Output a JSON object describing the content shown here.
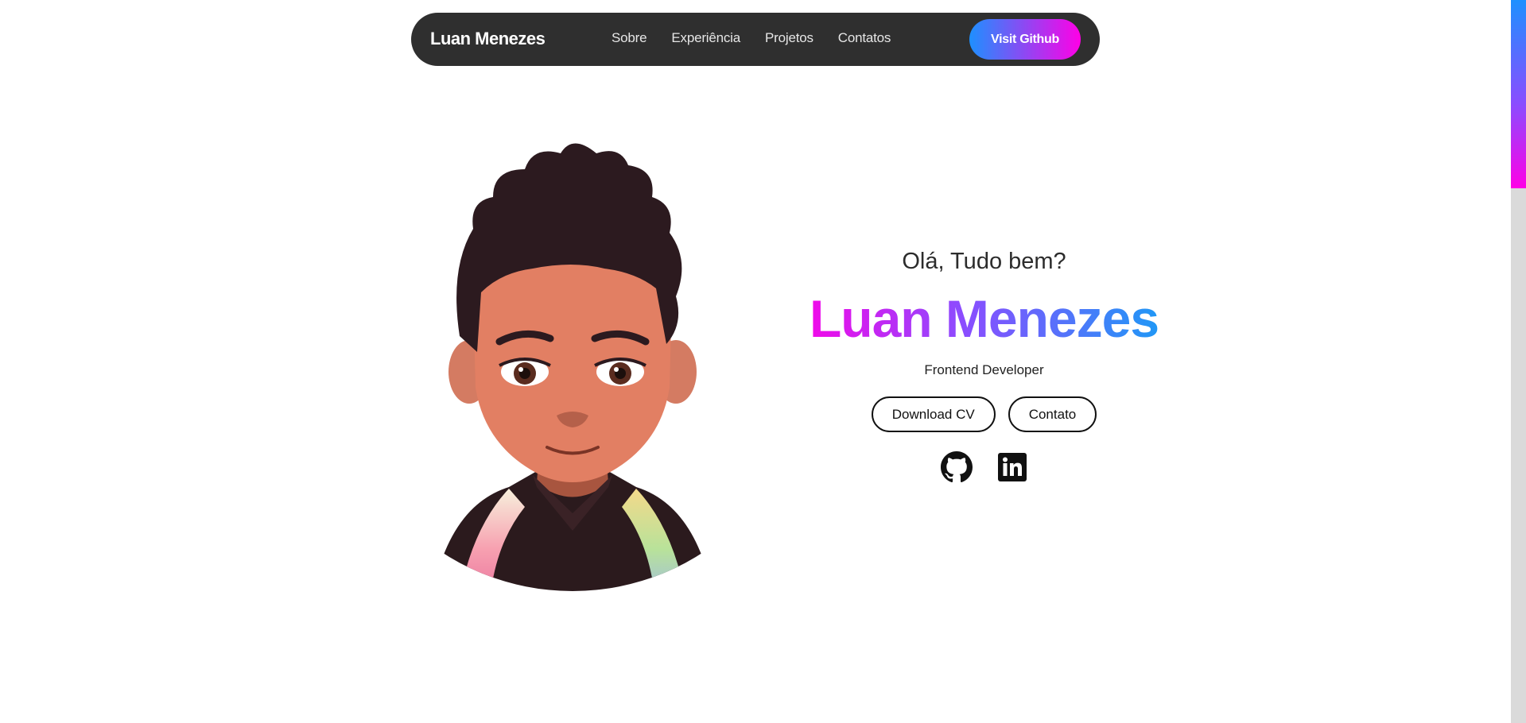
{
  "nav": {
    "brand": "Luan Menezes",
    "links": [
      "Sobre",
      "Experiência",
      "Projetos",
      "Contatos"
    ],
    "cta": "Visit Github"
  },
  "hero": {
    "greeting": "Olá, Tudo bem?",
    "name": "Luan Menezes",
    "role": "Frontend Developer",
    "buttons": {
      "download": "Download CV",
      "contact": "Contato"
    },
    "socials": [
      "github-icon",
      "linkedin-icon"
    ]
  },
  "colors": {
    "nav_bg": "#2f2f2f",
    "gradient_start": "#ff00e6",
    "gradient_mid": "#8a4dff",
    "gradient_end": "#14a0f5",
    "cta_start": "#1e90ff",
    "cta_end": "#ff00e6"
  }
}
